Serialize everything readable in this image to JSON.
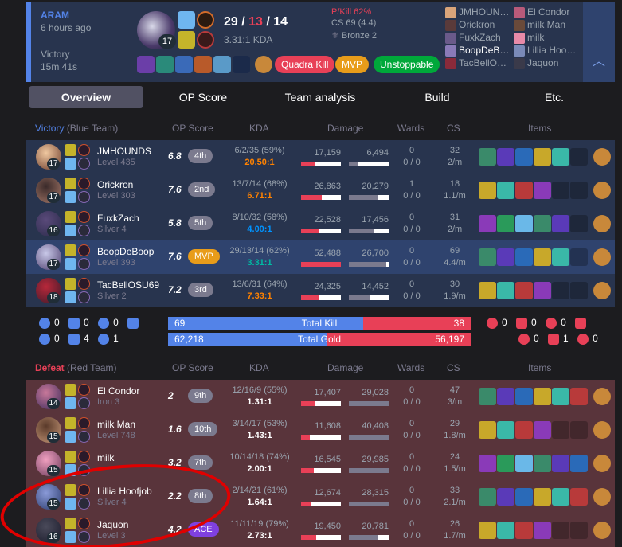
{
  "colors": {
    "blue": "#5383e8",
    "red": "#e84057",
    "mvp": "#e89c1a",
    "ace": "#7f40e0",
    "kda_orange": "#ff8200",
    "kda_blue": "#0093ff",
    "kda_teal": "#00bba3"
  },
  "header": {
    "mode": "ARAM",
    "ago": "6 hours ago",
    "result": "Victory",
    "duration": "15m 41s",
    "level": "17",
    "kills": "29",
    "deaths": "13",
    "assists": "14",
    "kda_ratio": "3.31:1 KDA",
    "pkill": "P/Kill 62%",
    "cs": "CS 69 (4.4)",
    "tier": "Bronze 2",
    "badges": [
      "Quadra Kill",
      "MVP",
      "Unstoppable"
    ],
    "players_left": [
      "JMHOUN…",
      "Orickron",
      "FuxkZach",
      "BoopDeB…",
      "TacBellO…"
    ],
    "players_right": [
      "El Condor",
      "milk Man",
      "milk",
      "Lillia Hoo…",
      "Jaquon"
    ],
    "toggle_icon": "chevron-up-icon"
  },
  "tabs": [
    "Overview",
    "OP Score",
    "Team analysis",
    "Build",
    "Etc."
  ],
  "blue_team": {
    "title": "Victory",
    "subtitle": "(Blue Team)",
    "cols": {
      "op": "OP Score",
      "kda": "KDA",
      "damage": "Damage",
      "wards": "Wards",
      "cs": "CS",
      "items": "Items"
    },
    "players": [
      {
        "name": "JMHOUNDS",
        "sub": "Level 435",
        "level": "17",
        "op": "6.8",
        "rank": "4th",
        "kda": "6/2/35 (59%)",
        "ratio": "20.50:1",
        "ratio_color": "orange",
        "dealt": "17,159",
        "taken": "6,494",
        "dealt_pct": 0.33,
        "taken_pct": 0.24,
        "wards": "0",
        "wards2": "0 / 0",
        "cs": "32",
        "cspm": "2/m"
      },
      {
        "name": "Orickron",
        "sub": "Level 303",
        "level": "17",
        "op": "7.6",
        "rank": "2nd",
        "kda": "13/7/14 (68%)",
        "ratio": "6.71:1",
        "ratio_color": "orange",
        "dealt": "26,863",
        "taken": "20,279",
        "dealt_pct": 0.51,
        "taken_pct": 0.72,
        "wards": "1",
        "wards2": "0 / 0",
        "cs": "18",
        "cspm": "1.1/m"
      },
      {
        "name": "FuxkZach",
        "sub": "Silver 4",
        "level": "16",
        "op": "5.8",
        "rank": "5th",
        "kda": "8/10/32 (58%)",
        "ratio": "4.00:1",
        "ratio_color": "blue",
        "dealt": "22,528",
        "taken": "17,456",
        "dealt_pct": 0.43,
        "taken_pct": 0.62,
        "wards": "0",
        "wards2": "0 / 0",
        "cs": "31",
        "cspm": "2/m"
      },
      {
        "name": "BoopDeBoop",
        "sub": "Level 393",
        "level": "17",
        "op": "7.6",
        "rank": "MVP",
        "kda": "29/13/14 (62%)",
        "ratio": "3.31:1",
        "ratio_color": "teal",
        "dealt": "52,488",
        "taken": "26,700",
        "dealt_pct": 1.0,
        "taken_pct": 0.94,
        "wards": "0",
        "wards2": "0 / 0",
        "cs": "69",
        "cspm": "4.4/m"
      },
      {
        "name": "TacBellOSU69",
        "sub": "Silver 2",
        "level": "18",
        "op": "7.2",
        "rank": "3rd",
        "kda": "13/6/31 (64%)",
        "ratio": "7.33:1",
        "ratio_color": "orange",
        "dealt": "24,325",
        "taken": "14,452",
        "dealt_pct": 0.46,
        "taken_pct": 0.51,
        "wards": "0",
        "wards2": "0 / 0",
        "cs": "30",
        "cspm": "1.9/m"
      }
    ]
  },
  "summary": {
    "blue_obj": [
      "0",
      "0",
      "0",
      "0",
      "0",
      "4",
      "1"
    ],
    "red_obj": [
      "0",
      "0",
      "0",
      "0",
      "0",
      "1",
      "0"
    ],
    "kill": {
      "label": "Total Kill",
      "blue": "69",
      "red": "38",
      "blue_pct": 0.645
    },
    "gold": {
      "label": "Total Gold",
      "blue": "62,218",
      "red": "56,197",
      "blue_pct": 0.525
    }
  },
  "red_team": {
    "title": "Defeat",
    "subtitle": "(Red Team)",
    "cols": {
      "op": "OP Score",
      "kda": "KDA",
      "damage": "Damage",
      "wards": "Wards",
      "cs": "CS",
      "items": "Items"
    },
    "players": [
      {
        "name": "El Condor",
        "sub": "Iron 3",
        "level": "14",
        "op": "2",
        "rank": "9th",
        "kda": "12/16/9 (55%)",
        "ratio": "1.31:1",
        "dealt": "17,407",
        "taken": "29,028",
        "dealt_pct": 0.33,
        "taken_pct": 1.0,
        "wards": "0",
        "wards2": "0 / 0",
        "cs": "47",
        "cspm": "3/m"
      },
      {
        "name": "milk Man",
        "sub": "Level 748",
        "level": "15",
        "op": "1.6",
        "rank": "10th",
        "kda": "3/14/17 (53%)",
        "ratio": "1.43:1",
        "dealt": "11,608",
        "taken": "40,408",
        "dealt_pct": 0.22,
        "taken_pct": 1.0,
        "wards": "0",
        "wards2": "0 / 0",
        "cs": "29",
        "cspm": "1.8/m"
      },
      {
        "name": "milk",
        "sub": "",
        "level": "15",
        "op": "3.2",
        "rank": "7th",
        "kda": "10/14/18 (74%)",
        "ratio": "2.00:1",
        "dealt": "16,545",
        "taken": "29,985",
        "dealt_pct": 0.32,
        "taken_pct": 1.0,
        "wards": "0",
        "wards2": "0 / 0",
        "cs": "24",
        "cspm": "1.5/m"
      },
      {
        "name": "Lillia Hoofjob",
        "sub": "Silver 4",
        "level": "15",
        "op": "2.2",
        "rank": "8th",
        "kda": "2/14/21 (61%)",
        "ratio": "1.64:1",
        "dealt": "12,674",
        "taken": "28,315",
        "dealt_pct": 0.24,
        "taken_pct": 1.0,
        "wards": "0",
        "wards2": "0 / 0",
        "cs": "33",
        "cspm": "2.1/m"
      },
      {
        "name": "Jaquon",
        "sub": "Level 3",
        "level": "16",
        "op": "4.2",
        "rank": "ACE",
        "kda": "11/11/19 (79%)",
        "ratio": "2.73:1",
        "dealt": "19,450",
        "taken": "20,781",
        "dealt_pct": 0.37,
        "taken_pct": 0.73,
        "wards": "0",
        "wards2": "0 / 0",
        "cs": "26",
        "cspm": "1.7/m"
      }
    ]
  }
}
